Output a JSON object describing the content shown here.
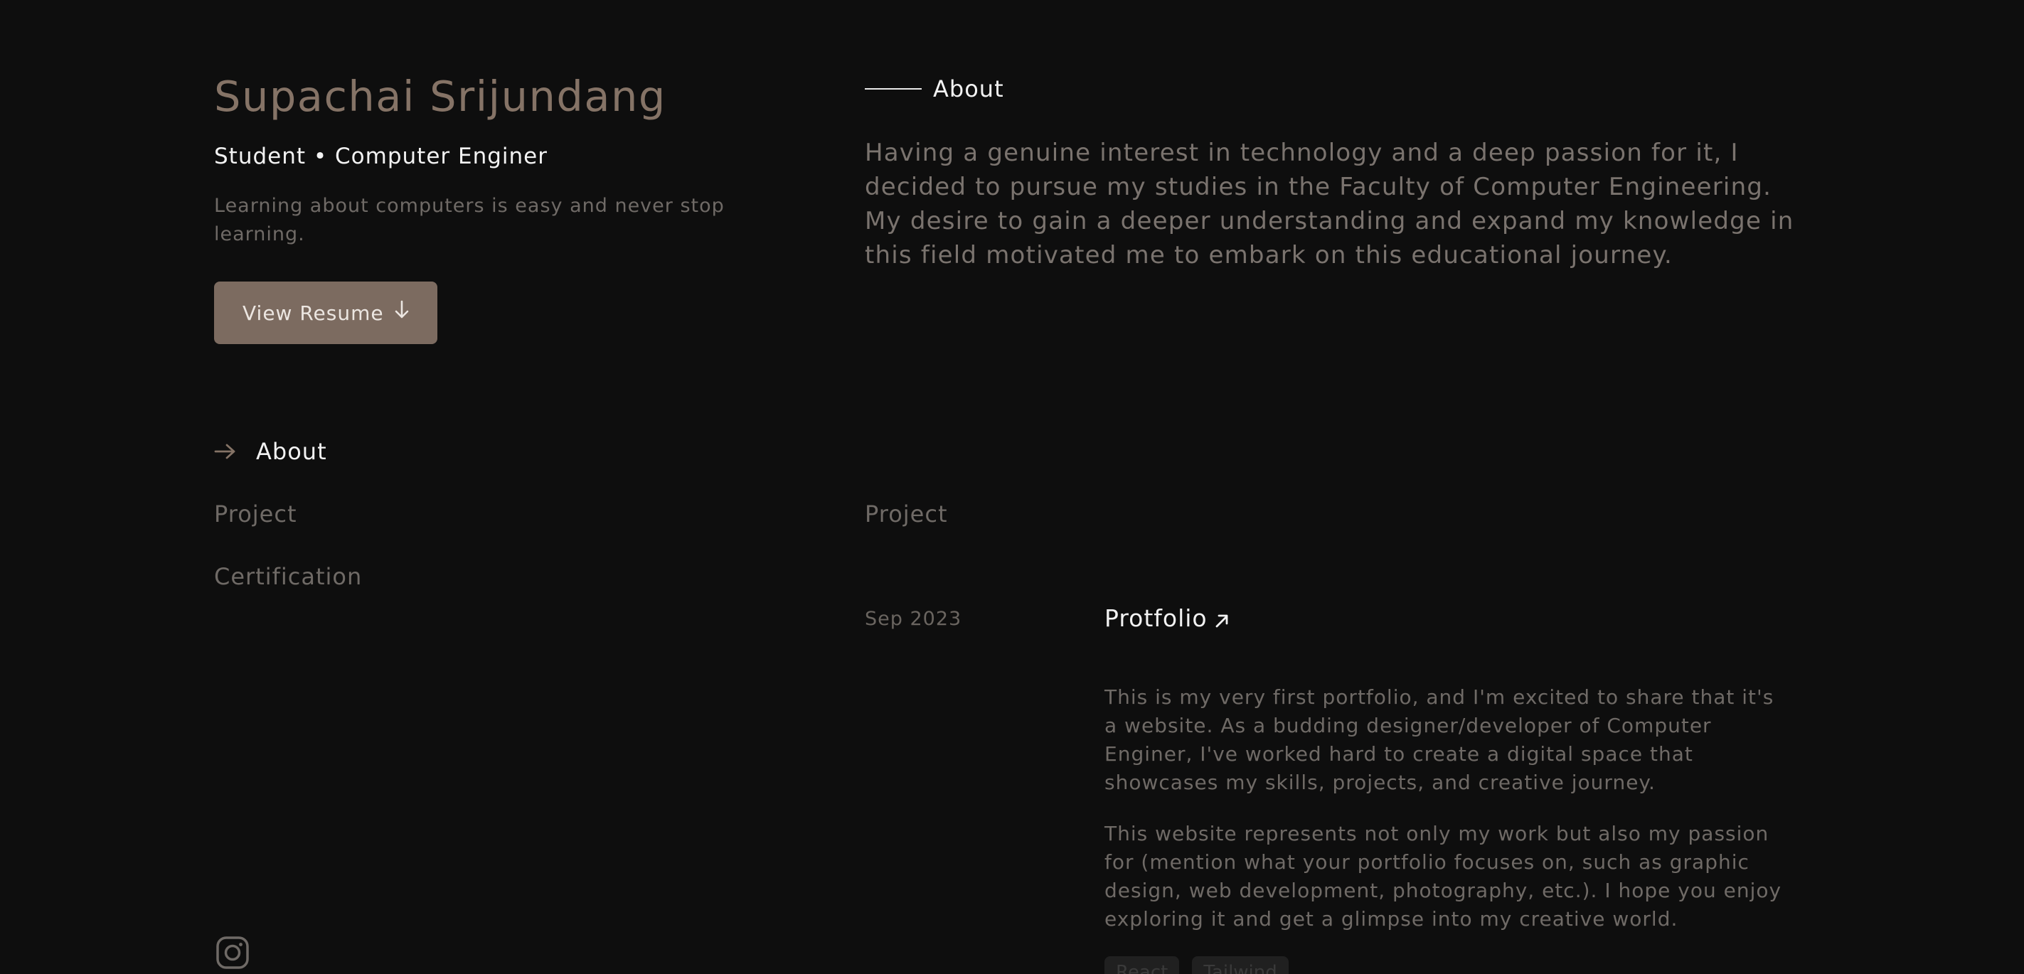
{
  "profile": {
    "name": "Supachai Srijundang",
    "role": "Student • Computer Enginer",
    "tagline": "Learning about computers is easy and never stop learning.",
    "resume_button": "View Resume"
  },
  "nav": {
    "items": [
      {
        "label": "About",
        "active": true
      },
      {
        "label": "Project",
        "active": false
      },
      {
        "label": "Certification",
        "active": false
      }
    ]
  },
  "about": {
    "heading": "About",
    "text": "Having a genuine interest in technology and a deep passion for it, I decided to pursue my studies in the Faculty of Computer Engineering. My desire to gain a deeper understanding and expand my knowledge in this field motivated me to embark on this educational journey."
  },
  "project": {
    "heading": "Project",
    "items": [
      {
        "date": "Sep 2023",
        "title": "Protfolio",
        "paragraphs": [
          "This is my very first portfolio, and I'm excited to share that it's a website. As a budding designer/developer of Computer Enginer, I've worked hard to create a digital space that showcases my skills, projects, and creative journey.",
          "This website represents not only my work but also my passion for (mention what your portfolio focuses on, such as graphic design, web development, photography, etc.). I hope you enjoy exploring it and get a glimpse into my creative world."
        ],
        "tags": [
          "React",
          "Tailwind"
        ]
      }
    ]
  },
  "icons": {
    "resume": "arrow-down-icon",
    "nav_active": "arrow-right-icon",
    "project_link": "arrow-up-right-icon",
    "social": "instagram-icon"
  },
  "colors": {
    "background": "#0e0e0e",
    "accent": "#857366",
    "button": "#7c6b60",
    "text_primary": "#f2f2f2",
    "text_muted": "#6f6a66"
  }
}
